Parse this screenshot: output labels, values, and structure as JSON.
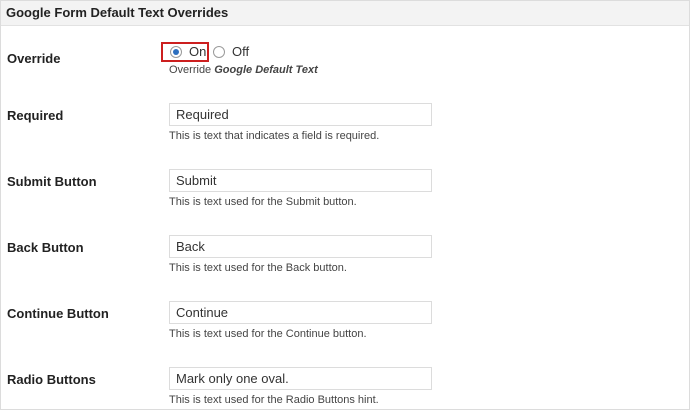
{
  "section": {
    "title": "Google Form Default Text Overrides"
  },
  "override": {
    "label": "Override",
    "options": [
      {
        "label": "On",
        "selected": true
      },
      {
        "label": "Off",
        "selected": false
      }
    ],
    "desc_prefix": "Override",
    "desc_emphasis": "Google Default Text"
  },
  "fields": [
    {
      "label": "Required",
      "value": "Required",
      "desc": "This is text that indicates a field is required."
    },
    {
      "label": "Submit Button",
      "value": "Submit",
      "desc": "This is text used for the Submit button."
    },
    {
      "label": "Back Button",
      "value": "Back",
      "desc": "This is text used for the Back button."
    },
    {
      "label": "Continue Button",
      "value": "Continue",
      "desc": "This is text used for the Continue button."
    },
    {
      "label": "Radio Buttons",
      "value": "Mark only one oval.",
      "desc": "This is text used for the Radio Buttons hint."
    }
  ],
  "colors": {
    "highlight": "#cc1f1f",
    "radio_accent": "#2d6fbf"
  }
}
